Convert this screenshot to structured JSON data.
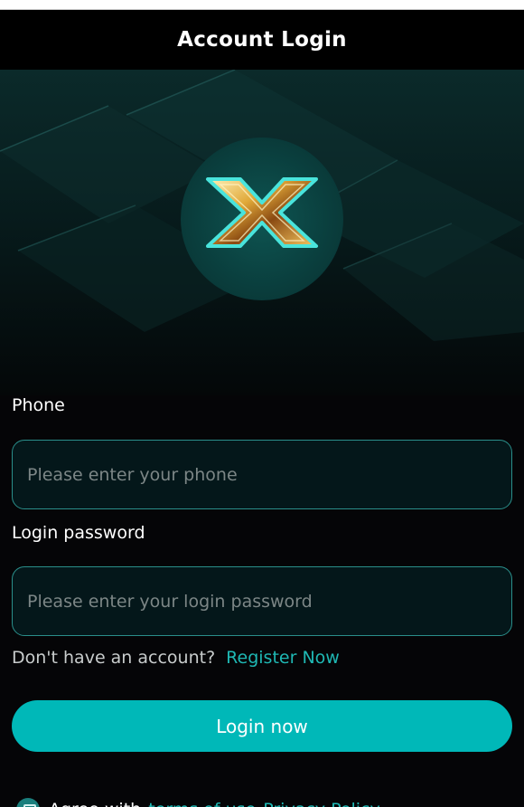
{
  "header": {
    "title": "Account Login"
  },
  "hero": {
    "logo_icon": "gold-x-logo-icon"
  },
  "form": {
    "phone_label": "Phone",
    "phone_placeholder": "Please enter your phone",
    "password_label": "Login password",
    "password_placeholder": "Please enter your login password",
    "no_account_text": "Don't have an account?",
    "register_link": "Register Now",
    "login_button": "Login now"
  },
  "agreement": {
    "checkbox_icon": "agree-checkbox-icon",
    "text": "Agree with",
    "terms_link": "terms of use",
    "privacy_link": "Privacy Policy"
  },
  "colors": {
    "accent": "#00b8b8",
    "link": "#1fb8b4",
    "background": "#050507",
    "field_border": "#2a8e8a"
  }
}
